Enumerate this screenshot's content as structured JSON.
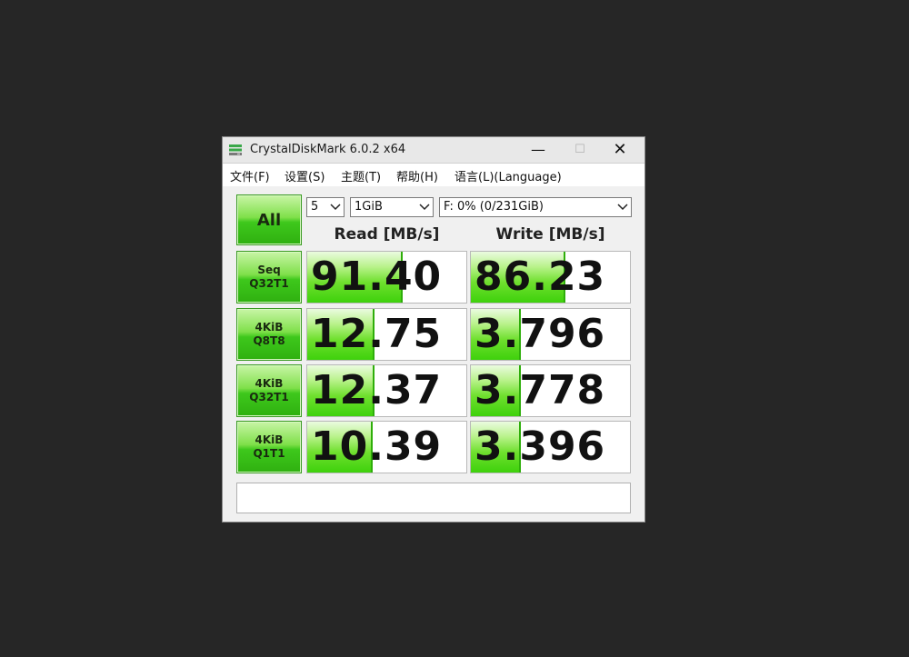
{
  "window": {
    "title": "CrystalDiskMark 6.0.2 x64",
    "controls": {
      "minimize": "—",
      "maximize": "☐",
      "close": "✕"
    }
  },
  "menu": [
    "文件(F)",
    "设置(S)",
    "主题(T)",
    "帮助(H)",
    "语言(L)(Language)"
  ],
  "toolbar": {
    "all_label": "All",
    "count": "5",
    "size": "1GiB",
    "drive": "F: 0% (0/231GiB)"
  },
  "columns": {
    "read": "Read [MB/s]",
    "write": "Write [MB/s]"
  },
  "tests": [
    {
      "line1": "Seq",
      "line2": "Q32T1",
      "read": "91.40",
      "write": "86.23",
      "read_fill": 0.59,
      "write_fill": 0.58
    },
    {
      "line1": "4KiB",
      "line2": "Q8T8",
      "read": "12.75",
      "write": "3.796",
      "read_fill": 0.41,
      "write_fill": 0.3
    },
    {
      "line1": "4KiB",
      "line2": "Q32T1",
      "read": "12.37",
      "write": "3.778",
      "read_fill": 0.41,
      "write_fill": 0.3
    },
    {
      "line1": "4KiB",
      "line2": "Q1T1",
      "read": "10.39",
      "write": "3.396",
      "read_fill": 0.4,
      "write_fill": 0.3
    }
  ],
  "comment": "",
  "colors": {
    "accent_green": "#3ec81c",
    "background": "#262626"
  }
}
